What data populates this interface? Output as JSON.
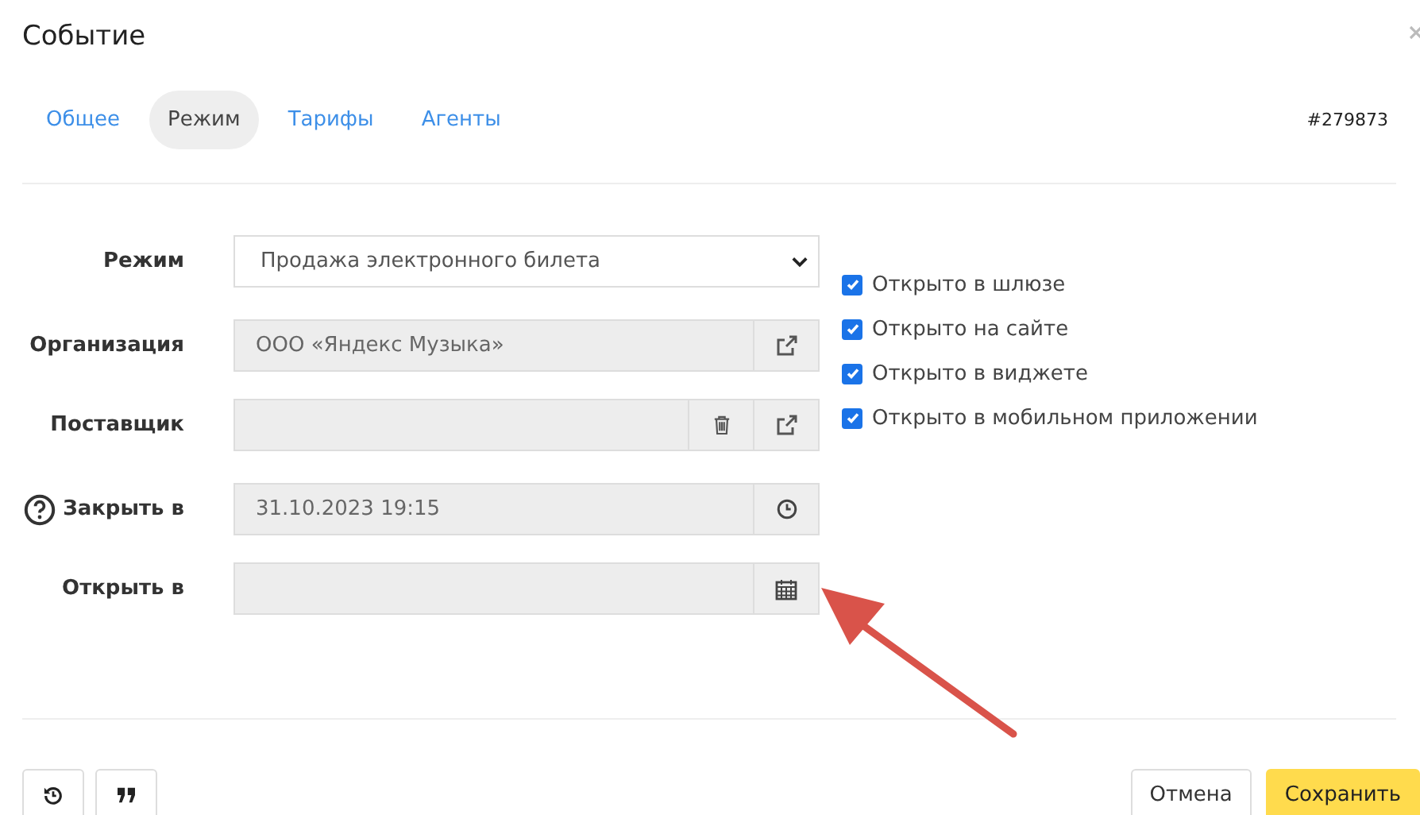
{
  "window": {
    "title": "Событие"
  },
  "tabs": [
    {
      "label": "Общее",
      "selected": false
    },
    {
      "label": "Режим",
      "selected": true
    },
    {
      "label": "Тарифы",
      "selected": false
    },
    {
      "label": "Агенты",
      "selected": false
    }
  ],
  "event_id": "#279873",
  "sections": [
    [
      {
        "label": "Режим",
        "kind": "select",
        "value": "Продажа электронного билета"
      }
    ],
    [
      {
        "label": "Организация",
        "kind": "input",
        "value": "ООО «Яндекс Музыка»",
        "addons": [
          {
            "kind": "link"
          }
        ]
      },
      {
        "label": "Поставщик",
        "kind": "input",
        "addons": [
          {
            "kind": "trash"
          },
          {
            "kind": "link"
          }
        ]
      }
    ],
    [
      {
        "label": "Закрыть в",
        "kind": "input",
        "value": "31.10.2023 19:15",
        "help": true,
        "addons": [
          {
            "kind": "clock"
          }
        ]
      },
      {
        "label": "Открыть в",
        "kind": "input",
        "addons": [
          {
            "kind": "calendar"
          }
        ]
      }
    ]
  ],
  "checkboxes": [
    {
      "label": "Открыто в шлюзе",
      "checked": true
    },
    {
      "label": "Открыто на сайте",
      "checked": true
    },
    {
      "label": "Открыто в виджете",
      "checked": true
    },
    {
      "label": "Открыто в мобильном приложении",
      "checked": true
    }
  ],
  "footer": {
    "left_buttons": [
      {
        "kind": "history"
      },
      {
        "kind": "quote"
      }
    ],
    "cancel": "Отмена",
    "save": "Сохранить"
  }
}
